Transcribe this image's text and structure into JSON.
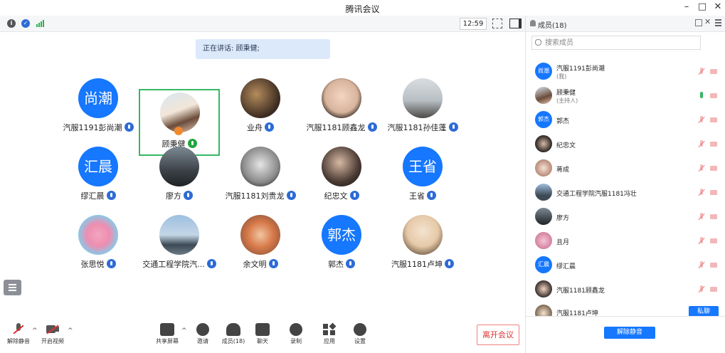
{
  "window": {
    "title": "腾讯会议"
  },
  "topbar": {
    "time": "12:59"
  },
  "speaking": "正在讲话: 顾秉健;",
  "tiles": [
    {
      "name": "汽服1191彭尚潮",
      "avatar_text": "尚潮"
    },
    {
      "name": "顾秉健",
      "avatar_text": ""
    },
    {
      "name": "业舟",
      "avatar_text": ""
    },
    {
      "name": "汽服1181顾鑫龙",
      "avatar_text": ""
    },
    {
      "name": "汽服1181孙佳蓬",
      "avatar_text": ""
    },
    {
      "name": "缪汇晨",
      "avatar_text": "汇晨"
    },
    {
      "name": "廖方",
      "avatar_text": ""
    },
    {
      "name": "汽服1181刘贵龙",
      "avatar_text": ""
    },
    {
      "name": "纪忠文",
      "avatar_text": ""
    },
    {
      "name": "王省",
      "avatar_text": "王省"
    },
    {
      "name": "张思悦",
      "avatar_text": ""
    },
    {
      "name": "交通工程学院汽...",
      "avatar_text": ""
    },
    {
      "name": "余文明",
      "avatar_text": ""
    },
    {
      "name": "郭杰",
      "avatar_text": "郭杰"
    },
    {
      "name": "汽服1181卢坤",
      "avatar_text": ""
    }
  ],
  "toolbar": {
    "unmute": "解除静音",
    "video": "开启视频",
    "share": "共享屏幕",
    "invite": "邀请",
    "members": "成员(18)",
    "chat": "聊天",
    "record": "录制",
    "apps": "应用",
    "settings": "设置",
    "leave": "离开会议"
  },
  "sidebar": {
    "title": "成员(18)",
    "search_placeholder": "搜索成员",
    "members": [
      {
        "name": "汽服1191彭尚潮",
        "sub": "(我)",
        "avatar_text": "尚潮"
      },
      {
        "name": "顾秉健",
        "sub": "(主持人)",
        "avatar_text": ""
      },
      {
        "name": "郭杰",
        "sub": "",
        "avatar_text": "郭杰"
      },
      {
        "name": "纪忠文",
        "sub": "",
        "avatar_text": ""
      },
      {
        "name": "蒋成",
        "sub": "",
        "avatar_text": ""
      },
      {
        "name": "交通工程学院汽服1181冯壮",
        "sub": "",
        "avatar_text": ""
      },
      {
        "name": "廖方",
        "sub": "",
        "avatar_text": ""
      },
      {
        "name": "且月",
        "sub": "",
        "avatar_text": ""
      },
      {
        "name": "缪汇晨",
        "sub": "",
        "avatar_text": "汇晨"
      },
      {
        "name": "汽服1181顾鑫龙",
        "sub": "",
        "avatar_text": ""
      },
      {
        "name": "汽服1181卢坤",
        "sub": "",
        "avatar_text": ""
      }
    ],
    "private_chat": "私聊",
    "unmute_all": "解除静音"
  },
  "colors": {
    "accent": "#1677ff",
    "selected_border": "#35b864",
    "leave": "#e0302f"
  }
}
